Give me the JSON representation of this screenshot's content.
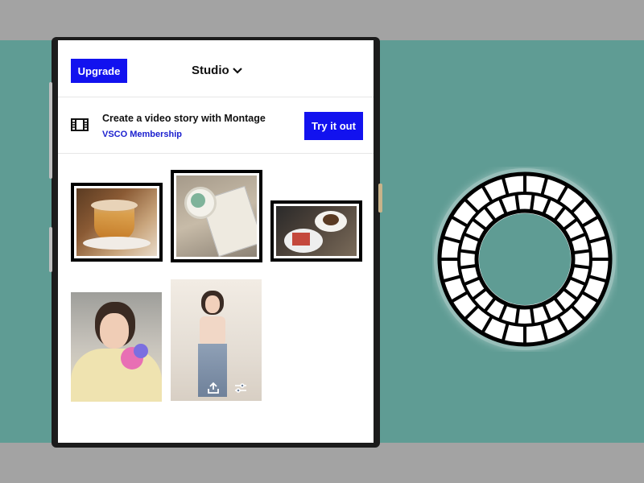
{
  "header": {
    "upgrade_label": "Upgrade",
    "studio_label": "Studio"
  },
  "banner": {
    "title": "Create a video story with Montage",
    "subtitle": "VSCO Membership",
    "cta_label": "Try it out"
  },
  "icons": {
    "studio_dropdown": "chevron-down-icon",
    "banner": "film-icon",
    "photo_export": "export-icon",
    "photo_edit": "sliders-icon"
  },
  "colors": {
    "accent": "#1212ef",
    "background_side": "#5f9c94",
    "background_band": "#a3a3a3"
  }
}
